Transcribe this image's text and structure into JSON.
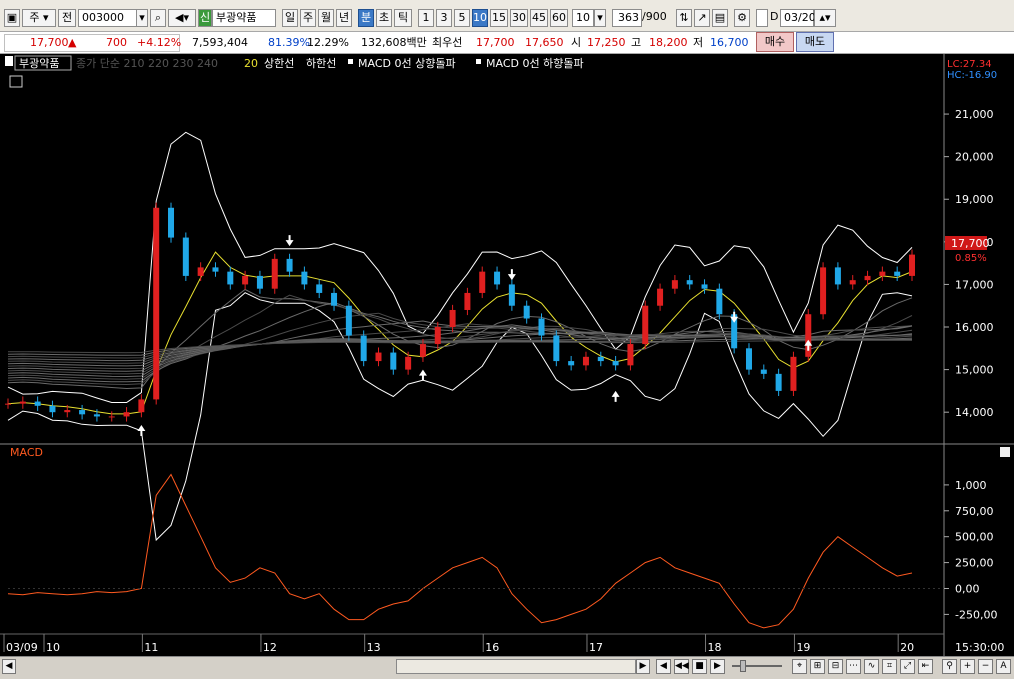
{
  "toolbar": {
    "market_label": "주",
    "prev_label": "전",
    "code_value": "003000",
    "stock_badge": "신",
    "stock_name": "부광약품",
    "period_daily": "일",
    "period_weekly": "주",
    "period_monthly": "월",
    "period_yearly": "년",
    "period_minute": "분",
    "period_second": "초",
    "period_tick": "틱",
    "intervals": [
      "1",
      "3",
      "5",
      "10",
      "15",
      "30",
      "45",
      "60"
    ],
    "selected_interval": "10",
    "interval_input": "10",
    "count_value": "363",
    "count_total": "/900",
    "d_label": "D",
    "date_value": "03/20"
  },
  "quote": {
    "price": "17,700",
    "up_arrow": "▲",
    "change": "700",
    "change_pct": "+4.12%",
    "volume": "7,593,404",
    "volume_ratio": "81.39%",
    "turnover_ratio": "12.29%",
    "amount": "132,608백만",
    "best_ask_label": "최우선",
    "best_ask": "17,700",
    "best_bid": "17,650",
    "open_label": "시",
    "open": "17,250",
    "high_label": "고",
    "high": "18,200",
    "low_label": "저",
    "low": "16,700",
    "buy_label": "매수",
    "sell_label": "매도"
  },
  "legend": {
    "name": "부광약품",
    "ma_text": "종가 단순 210  220  230  240",
    "bb_period": "20",
    "bb_upper": "상한선",
    "bb_lower": "하한선",
    "macd_up": "MACD 0선 상향돌파",
    "macd_down": "MACD 0선 하향돌파",
    "lc": "LC:27.34",
    "hc": "HC:-16.90",
    "current_price": "17,700",
    "current_pct": "0.85%",
    "macd_title": "MACD"
  },
  "price_axis": [
    "21,000",
    "20,000",
    "19,000",
    "18,000",
    "17,000",
    "16,000",
    "15,000",
    "14,000"
  ],
  "macd_axis": [
    "1,000",
    "750,00",
    "500,00",
    "250,00",
    "0,00",
    "-250,00"
  ],
  "time_axis": [
    "03/09",
    "10",
    "11",
    "12",
    "13",
    "16",
    "17",
    "18",
    "19",
    "20",
    "15:30:00"
  ],
  "chart_data": {
    "type": "line",
    "title": "부광약품",
    "price_ylim": [
      13300,
      21800
    ],
    "macd_ylim": [
      -420,
      1250
    ],
    "days": [
      "03/09",
      "10",
      "11",
      "12",
      "13",
      "16",
      "17",
      "18",
      "19",
      "20"
    ],
    "series": [
      {
        "name": "close",
        "values": [
          14200,
          14250,
          14150,
          14000,
          14050,
          13950,
          13900,
          13900,
          14000,
          14300,
          18800,
          18100,
          17200,
          17400,
          17300,
          17000,
          17200,
          16900,
          17600,
          17300,
          17000,
          16800,
          16500,
          15800,
          15200,
          15400,
          15000,
          15300,
          15600,
          16000,
          16400,
          16800,
          17300,
          17000,
          16500,
          16200,
          15800,
          15200,
          15100,
          15300,
          15200,
          15100,
          15600,
          16500,
          16900,
          17100,
          17000,
          16900,
          16300,
          15500,
          15000,
          14900,
          14500,
          15300,
          16300,
          17400,
          17000,
          17100,
          17200,
          17300,
          17200,
          17700
        ]
      },
      {
        "name": "MACD",
        "values": [
          -50,
          -60,
          -40,
          -50,
          -60,
          -50,
          -30,
          -40,
          -30,
          0,
          900,
          1100,
          800,
          500,
          200,
          60,
          100,
          200,
          150,
          -50,
          -100,
          -50,
          -200,
          -300,
          -300,
          -200,
          -150,
          -120,
          0,
          100,
          200,
          250,
          300,
          200,
          -50,
          -200,
          -330,
          -300,
          -250,
          -200,
          -100,
          50,
          150,
          250,
          300,
          200,
          150,
          100,
          50,
          -150,
          -330,
          -380,
          -350,
          -200,
          100,
          350,
          500,
          400,
          300,
          200,
          120,
          150
        ]
      }
    ]
  },
  "bottom": {
    "plus": "+",
    "minus": "−",
    "a": "A"
  }
}
